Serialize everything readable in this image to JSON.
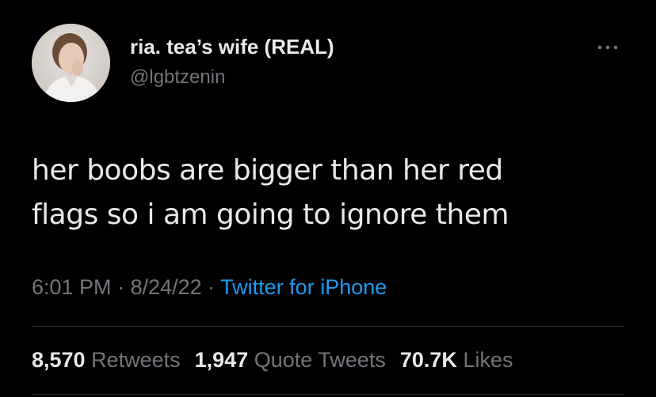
{
  "user": {
    "display_name": "ria. tea’s wife (REAL)",
    "handle": "@lgbtzenin",
    "avatar_icon": "profile-photo"
  },
  "more_icon": "ellipsis-icon",
  "tweet": {
    "text_line1": "her boobs are bigger than her red",
    "text_line2": "flags so i am going to ignore them"
  },
  "meta": {
    "time": "6:01 PM",
    "separator1": " · ",
    "date": "8/24/22",
    "separator2": " · ",
    "source": "Twitter for iPhone"
  },
  "stats": {
    "retweets_count": "8,570",
    "retweets_label": "Retweets",
    "quotes_count": "1,947",
    "quotes_label": "Quote Tweets",
    "likes_count": "70.7K",
    "likes_label": "Likes"
  },
  "colors": {
    "background": "#000000",
    "text_primary": "#e7e9ea",
    "text_secondary": "#71767b",
    "link": "#1d9bf0",
    "divider": "#2f3336"
  }
}
